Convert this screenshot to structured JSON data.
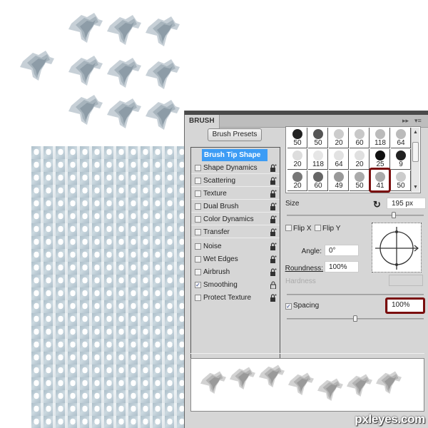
{
  "canvas": {
    "description": "brush stamps on canvas",
    "stamp_color": "#9aa8b2"
  },
  "panel": {
    "tab_label": "BRUSH",
    "tab_controls": {
      "expand": "▸▸",
      "menu": "▾≡"
    },
    "presets_button": "Brush Presets",
    "options": [
      {
        "label": "Brush Tip Shape",
        "checkbox": false,
        "active": true,
        "locked": false
      },
      {
        "label": "Shape Dynamics",
        "checked": false,
        "locked": true
      },
      {
        "label": "Scattering",
        "checked": false,
        "locked": true
      },
      {
        "label": "Texture",
        "checked": false,
        "locked": true
      },
      {
        "label": "Dual Brush",
        "checked": false,
        "locked": true
      },
      {
        "label": "Color Dynamics",
        "checked": false,
        "locked": true
      },
      {
        "label": "Transfer",
        "checked": false,
        "locked": true
      },
      {
        "label": "Noise",
        "checked": false,
        "locked": true
      },
      {
        "label": "Wet Edges",
        "checked": false,
        "locked": true
      },
      {
        "label": "Airbrush",
        "checked": false,
        "locked": true
      },
      {
        "label": "Smoothing",
        "checked": true,
        "locked": false
      },
      {
        "label": "Protect Texture",
        "checked": false,
        "locked": true
      }
    ],
    "brush_tips": [
      [
        "50",
        "50",
        "20",
        "60",
        "118",
        "64"
      ],
      [
        "20",
        "118",
        "64",
        "20",
        "25",
        "9"
      ],
      [
        "20",
        "60",
        "49",
        "50",
        "41",
        "50"
      ]
    ],
    "selected_tip": "41",
    "size_label": "Size",
    "size_value": "195 px",
    "size_slider_fraction": 0.78,
    "flip_x_label": "Flip X",
    "flip_y_label": "Flip Y",
    "angle_label": "Angle:",
    "angle_value": "0°",
    "roundness_label": "Roundness:",
    "roundness_value": "100%",
    "hardness_label": "Hardness",
    "spacing_label": "Spacing",
    "spacing_checked": true,
    "spacing_value": "100%",
    "spacing_slider_fraction": 0.5,
    "check_mark": "✓",
    "reset_icon": "↻",
    "highlight_color": "#7a0e0e",
    "active_color": "#3c9cf5"
  },
  "watermark": "pxleyes.com"
}
